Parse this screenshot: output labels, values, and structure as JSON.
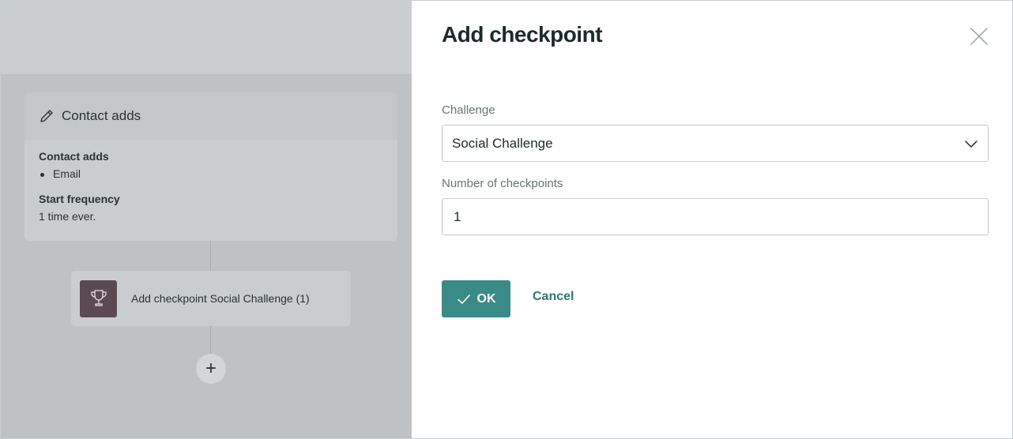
{
  "canvas": {
    "trigger": {
      "title": "Contact adds",
      "section_label": "Contact adds",
      "items": [
        "Email"
      ],
      "frequency_label": "Start frequency",
      "frequency_value": "1 time ever."
    },
    "action": {
      "label": "Add checkpoint Social Challenge (1)",
      "icon": "trophy-icon",
      "icon_bg": "#5b4a51"
    },
    "add_button_glyph": "+"
  },
  "drawer": {
    "title": "Add checkpoint",
    "challenge_label": "Challenge",
    "challenge_value": "Social Challenge",
    "checkpoints_label": "Number of checkpoints",
    "checkpoints_value": "1",
    "ok_label": "OK",
    "cancel_label": "Cancel",
    "accent": "#3a8a87"
  }
}
